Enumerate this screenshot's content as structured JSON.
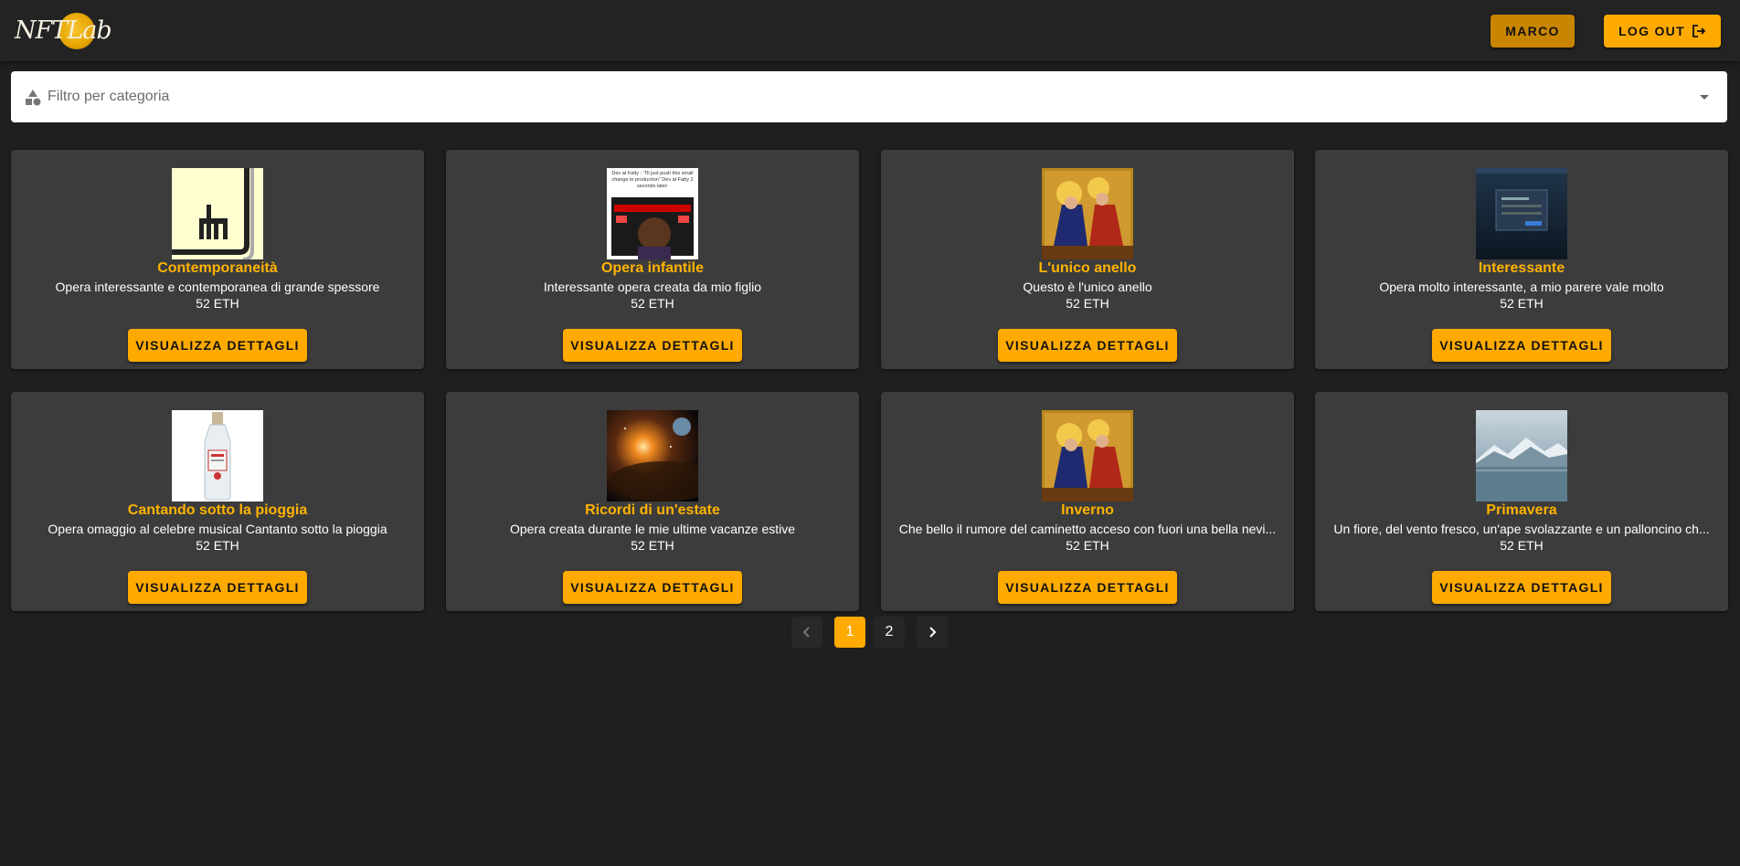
{
  "header": {
    "logo_text": "NFTLab",
    "user_label": "MARCO",
    "logout_label": "LOG OUT",
    "logout_icon": "logout-icon"
  },
  "filter": {
    "placeholder": "Filtro per categoria",
    "icon": "category-icon"
  },
  "cards": [
    {
      "title": "Contemporaneità",
      "description": "Opera interessante e contemporanea di grande spessore",
      "price": "52 ETH",
      "button": "VISUALIZZA DETTAGLI"
    },
    {
      "title": "Opera infantile",
      "description": "Interessante opera creata da mio figlio",
      "price": "52 ETH",
      "button": "VISUALIZZA DETTAGLI",
      "meme_text": "Dev at Fatty : \"I'll just push this small change to production\"  Dev at Fatty 2 seconds later:"
    },
    {
      "title": "L'unico anello",
      "description": "Questo è l'unico anello",
      "price": "52 ETH",
      "button": "VISUALIZZA DETTAGLI"
    },
    {
      "title": "Interessante",
      "description": "Opera molto interessante, a mio parere vale molto",
      "price": "52 ETH",
      "button": "VISUALIZZA DETTAGLI"
    },
    {
      "title": "Cantando sotto la pioggia",
      "description": "Opera omaggio al celebre musical Cantanto sotto la pioggia",
      "price": "52 ETH",
      "button": "VISUALIZZA DETTAGLI"
    },
    {
      "title": "Ricordi di un'estate",
      "description": "Opera creata durante le mie ultime vacanze estive",
      "price": "52 ETH",
      "button": "VISUALIZZA DETTAGLI"
    },
    {
      "title": "Inverno",
      "description": "Che bello il rumore del caminetto acceso con fuori una bella nevi...",
      "price": "52 ETH",
      "button": "VISUALIZZA DETTAGLI"
    },
    {
      "title": "Primavera",
      "description": "Un fiore, del vento fresco, un'ape svolazzante e un palloncino ch...",
      "price": "52 ETH",
      "button": "VISUALIZZA DETTAGLI"
    }
  ],
  "pagination": {
    "pages": [
      "1",
      "2"
    ],
    "current": "1"
  },
  "colors": {
    "accent": "#ffaa00",
    "user_button": "#c88500",
    "background": "#1f1f1f",
    "card": "#3c3c3c",
    "title": "#ffb300"
  }
}
